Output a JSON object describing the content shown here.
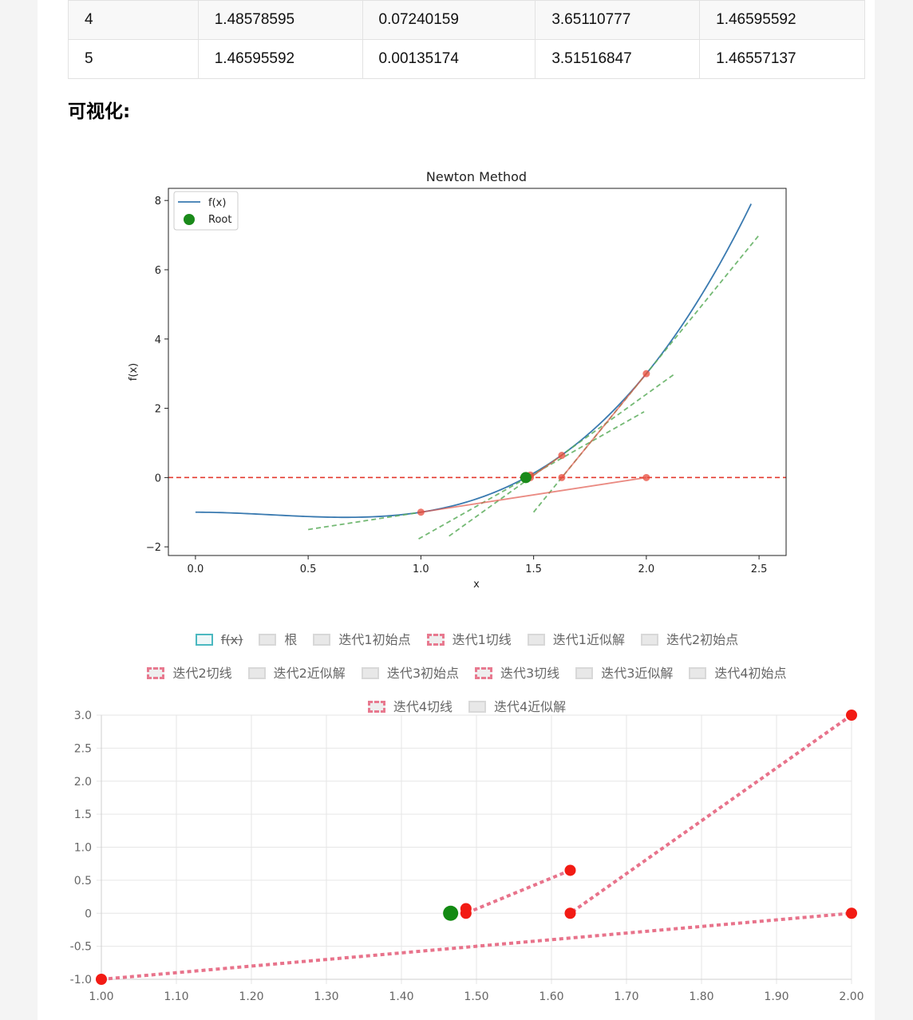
{
  "table": {
    "rows": [
      [
        "4",
        "1.48578595",
        "0.07240159",
        "3.65110777",
        "1.46595592"
      ],
      [
        "5",
        "1.46595592",
        "0.00135174",
        "3.51516847",
        "1.46557137"
      ]
    ]
  },
  "section_title": "可视化:",
  "chart_data": [
    {
      "type": "line",
      "title": "Newton Method",
      "xlabel": "x",
      "ylabel": "f(x)",
      "xlim": [
        -0.12,
        2.62
      ],
      "ylim": [
        -2.25,
        8.35
      ],
      "x_ticks": [
        0.0,
        0.5,
        1.0,
        1.5,
        2.0,
        2.5
      ],
      "x_tick_labels": [
        "0.0",
        "0.5",
        "1.0",
        "1.5",
        "2.0",
        "2.5"
      ],
      "y_ticks": [
        -2,
        0,
        2,
        4,
        6,
        8
      ],
      "y_tick_labels": [
        "−2",
        "0",
        "2",
        "4",
        "6",
        "8"
      ],
      "legend": {
        "position": "top-left",
        "entries": [
          "f(x)",
          "Root"
        ]
      },
      "curve": {
        "name": "f(x)",
        "x_range": [
          0,
          2.465
        ],
        "color": "#3a7ab0"
      },
      "zero_line": {
        "y": 0,
        "color": "#e33b2f",
        "style": "dashed"
      },
      "root": {
        "name": "Root",
        "x": 1.46557,
        "y": 0,
        "color": "#1a8a1a"
      },
      "iteration_points": [
        {
          "x": 2.0,
          "y": 3.0
        },
        {
          "x": 1.625,
          "y": 0.640625
        },
        {
          "x": 1.625,
          "y": 0.0
        },
        {
          "x": 1.48578595,
          "y": 0.07240159
        },
        {
          "x": 1.48578595,
          "y": 0.0
        },
        {
          "x": 1.0,
          "y": -1.0
        },
        {
          "x": 2.0,
          "y": 0.0
        }
      ],
      "newton_segments": [
        {
          "x": [
            2.0,
            1.625
          ],
          "y": [
            3.0,
            0.0
          ]
        },
        {
          "x": [
            1.625,
            1.48578595
          ],
          "y": [
            0.640625,
            0.0
          ]
        },
        {
          "x": [
            1.48578595,
            1.46595592
          ],
          "y": [
            0.07240159,
            0.0
          ]
        },
        {
          "x": [
            1.0,
            2.0
          ],
          "y": [
            -1.0,
            0.0
          ]
        }
      ],
      "tangents": [
        {
          "x": [
            0.5,
            1.0
          ],
          "y": [
            -1.5,
            -1.0
          ]
        },
        {
          "x": [
            0.99,
            1.99
          ],
          "y": [
            -1.77,
            1.9
          ]
        },
        {
          "x": [
            1.125,
            2.125
          ],
          "y": [
            -1.69,
            2.99
          ]
        },
        {
          "x": [
            1.5,
            2.5
          ],
          "y": [
            -1.0,
            7.0
          ]
        }
      ],
      "colors": {
        "tangent": "#5cad5c",
        "point": "#e84b3c",
        "segment": "#e25a4e"
      }
    },
    {
      "type": "scatter",
      "x_ticks": [
        1.0,
        1.1,
        1.2,
        1.3,
        1.4,
        1.5,
        1.6,
        1.7,
        1.8,
        1.9,
        2.0
      ],
      "x_tick_labels": [
        "1.00",
        "1.10",
        "1.20",
        "1.30",
        "1.40",
        "1.50",
        "1.60",
        "1.70",
        "1.80",
        "1.90",
        "2.00"
      ],
      "y_ticks": [
        -1.0,
        -0.5,
        0,
        0.5,
        1.0,
        1.5,
        2.0,
        2.5,
        3.0
      ],
      "y_tick_labels": [
        "-1.0",
        "-0.5",
        "0",
        "0.5",
        "1.0",
        "1.5",
        "2.0",
        "2.5",
        "3.0"
      ],
      "xlim": [
        1.0,
        2.0
      ],
      "ylim": [
        -1.0,
        3.0
      ],
      "grid": true,
      "legend": {
        "position": "top",
        "items": [
          {
            "label": "f(x)",
            "style": "f",
            "hidden": true
          },
          {
            "label": "根",
            "style": "box"
          },
          {
            "label": "迭代1初始点",
            "style": "box"
          },
          {
            "label": "迭代1切线",
            "style": "t"
          },
          {
            "label": "迭代1近似解",
            "style": "box"
          },
          {
            "label": "迭代2初始点",
            "style": "box"
          },
          {
            "label": "迭代2切线",
            "style": "t"
          },
          {
            "label": "迭代2近似解",
            "style": "box"
          },
          {
            "label": "迭代3初始点",
            "style": "box"
          },
          {
            "label": "迭代3切线",
            "style": "t"
          },
          {
            "label": "迭代3近似解",
            "style": "box"
          },
          {
            "label": "迭代4初始点",
            "style": "box"
          },
          {
            "label": "迭代4切线",
            "style": "t"
          },
          {
            "label": "迭代4近似解",
            "style": "box"
          }
        ]
      },
      "root": {
        "x": 1.46557,
        "y": 0,
        "color": "#138a13"
      },
      "points": [
        {
          "x": 1.0,
          "y": -1.0
        },
        {
          "x": 2.0,
          "y": 0.0
        },
        {
          "x": 2.0,
          "y": 3.0
        },
        {
          "x": 1.625,
          "y": 0.0
        },
        {
          "x": 1.625,
          "y": 0.65
        },
        {
          "x": 1.486,
          "y": 0.0
        },
        {
          "x": 1.486,
          "y": 0.07
        }
      ],
      "tangent_lines": [
        {
          "x": [
            1.0,
            2.0
          ],
          "y": [
            -1.0,
            0.0
          ]
        },
        {
          "x": [
            2.0,
            1.625
          ],
          "y": [
            3.0,
            0.0
          ]
        },
        {
          "x": [
            1.625,
            1.486
          ],
          "y": [
            0.65,
            0.0
          ]
        }
      ],
      "colors": {
        "point": "#f21b14",
        "line": "#e8738b",
        "grid": "#e6e6e6",
        "tick": "#666666"
      }
    }
  ]
}
